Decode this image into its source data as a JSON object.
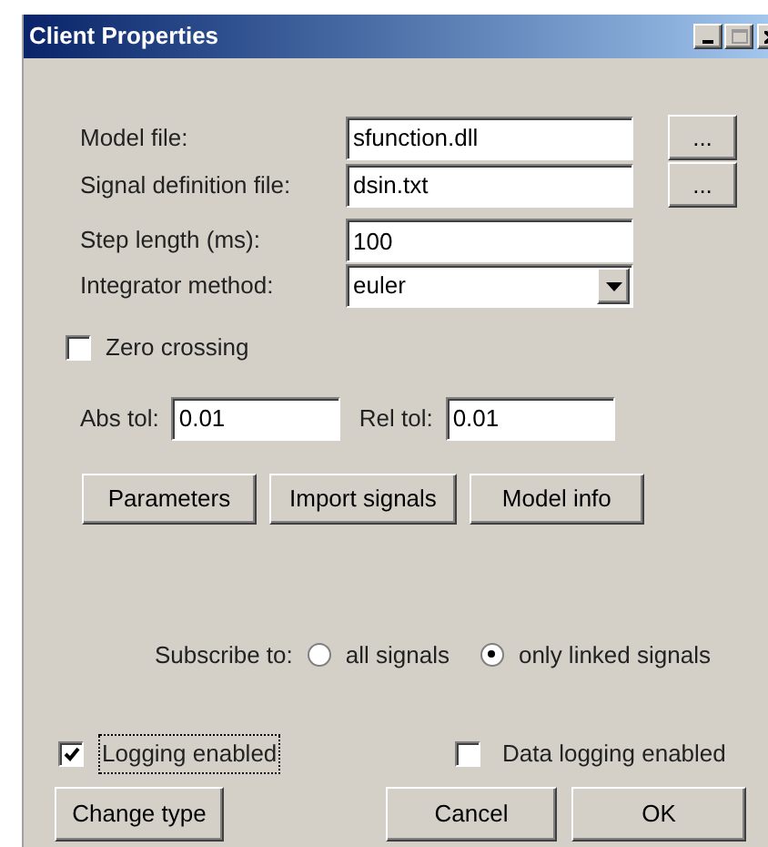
{
  "window": {
    "title": "Client Properties"
  },
  "fields": [
    {
      "kind": "file",
      "label": "Model file:",
      "value": "sfunction.dll",
      "browse": "..."
    },
    {
      "kind": "file",
      "label": "Signal definition file:",
      "value": "dsin.txt",
      "browse": "..."
    },
    {
      "kind": "text",
      "label": "Step length (ms):",
      "value": "100"
    },
    {
      "kind": "combo",
      "label": "Integrator method:",
      "value": "euler"
    }
  ],
  "zero_crossing": {
    "label": "Zero crossing",
    "checked": false
  },
  "tolerances": [
    {
      "label": "Abs tol:",
      "value": "0.01"
    },
    {
      "label": "Rel tol:",
      "value": "0.01"
    }
  ],
  "action_buttons": [
    "Parameters",
    "Import signals",
    "Model info"
  ],
  "subscribe": {
    "label": "Subscribe to:",
    "options": [
      {
        "label": "all signals",
        "selected": false
      },
      {
        "label": "only linked signals",
        "selected": true
      }
    ]
  },
  "logging": {
    "label": "Logging enabled",
    "checked": true,
    "focused": true
  },
  "data_logging": {
    "label": "Data logging enabled",
    "checked": false
  },
  "footer_buttons": {
    "change_type": "Change type",
    "cancel": "Cancel",
    "ok": "OK"
  }
}
